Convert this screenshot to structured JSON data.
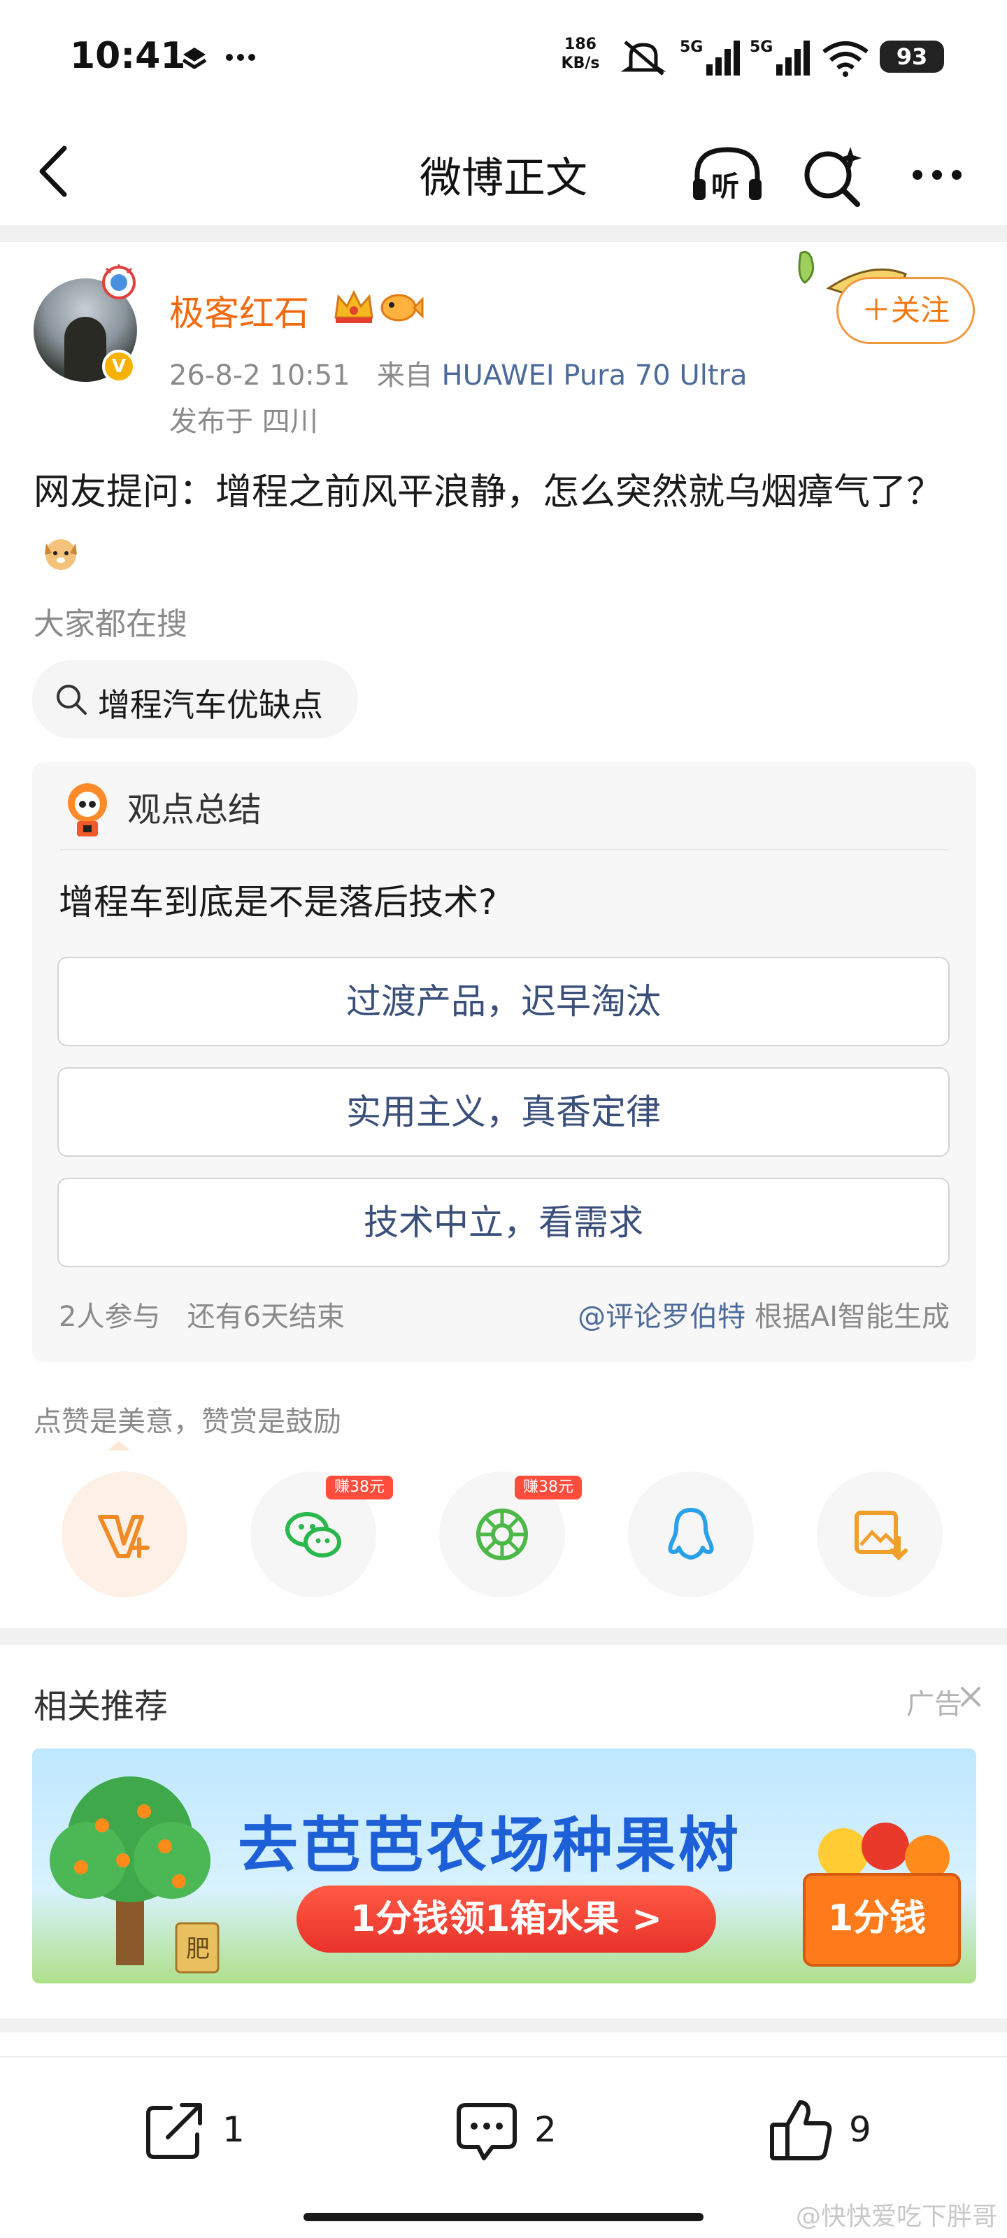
{
  "status_bar": {
    "time": "10:41",
    "net_speed_value": "186",
    "net_speed_unit": "KB/s",
    "battery": "93",
    "icons": [
      "layers-icon",
      "dots-icon",
      "mute-bell-icon",
      "signal-5g-icon",
      "signal-5g-icon",
      "wifi-icon",
      "battery-icon"
    ]
  },
  "header": {
    "title": "微博正文",
    "icons": [
      "back-icon",
      "headphones-listen-icon",
      "ai-search-icon",
      "more-icon"
    ]
  },
  "post": {
    "author": "极客红石",
    "timestamp": "26-8-2 10:51",
    "source_prefix": "来自",
    "device": "HUAWEI Pura 70 Ultra",
    "location": "发布于 四川",
    "follow_label": "＋关注",
    "text": "网友提问：增程之前风平浪静，怎么突然就乌烟瘴气了？"
  },
  "trending": {
    "label": "大家都在搜",
    "query": "增程汽车优缺点"
  },
  "poll": {
    "header": "观点总结",
    "question": "增程车到底是不是落后技术?",
    "options": [
      {
        "label": "过渡产品，迟早淘汰"
      },
      {
        "label": "实用主义，真香定律"
      },
      {
        "label": "技术中立，看需求"
      }
    ],
    "participants": "2人参与",
    "remaining": "还有6天结束",
    "generator_handle": "@评论罗伯特",
    "generator_suffix": "根据AI智能生成"
  },
  "reward": {
    "note": "点赞是美意，赞赏是鼓励",
    "earn_badge": "赚38元",
    "share_targets": [
      "reward-v-icon",
      "wechat-icon",
      "moments-icon",
      "qq-icon",
      "save-image-icon"
    ]
  },
  "related": {
    "title": "相关推荐",
    "ad_label": "广告",
    "ad_headline": "去芭芭农场种果树",
    "ad_cta": "1分钱领1箱水果 >",
    "ad_box_text": "1分钱",
    "ad_crate_text": "肥"
  },
  "bottom_bar": {
    "share_count": "1",
    "comment_count": "2",
    "like_count": "9"
  },
  "watermark": "@快快爱吃下胖哥",
  "colors": {
    "accent_orange": "#f26a10",
    "link_blue": "#4d6b9a",
    "earn_red": "#ff4d3d"
  }
}
